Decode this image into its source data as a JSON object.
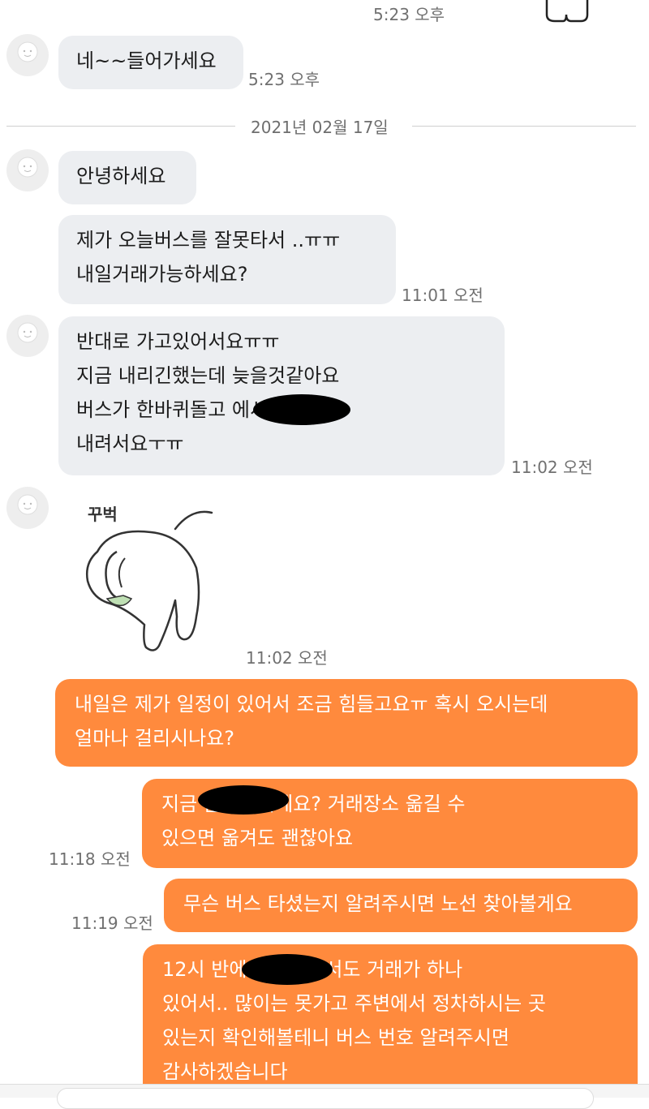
{
  "chat": {
    "top_partial_time": "5:23 오후",
    "m1": {
      "text": "네~~들어가세요",
      "time": "5:23 오후"
    },
    "date_divider": "2021년 02월 17일",
    "m2": {
      "text": "안녕하세요"
    },
    "m3": {
      "text": "제가 오늘버스를  잘못타서 ..ㅠㅠ\n내일거래가능하세요?",
      "time": "11:01 오전"
    },
    "m4": {
      "text": "반대로 가고있어서요ㅠㅠ\n지금  내리긴했는데  늦을것같아요\n버스가  한바퀴돌고            에서\n내려서요ㅜㅠ",
      "time": "11:02 오전"
    },
    "sticker": {
      "caption": "꾸벅",
      "time": "11:02 오전",
      "icon": "bowing-bunny-sticker"
    },
    "m5": {
      "text": "내일은 제가 일정이 있어서 조금 힘들고요ㅠ 혹시 오시는데\n얼마나 걸리시나요?"
    },
    "m6": {
      "text": "지금              쯤이신거에요? 거래장소 옮길 수\n있으면 옮겨도 괜찮아요",
      "time": "11:18 오전"
    },
    "m7": {
      "text": "무슨 버스 타셨는지 알려주시면 노선 찾아볼게요",
      "time": "11:19 오전"
    },
    "m8": {
      "text": "12시 반에              정문쪽에서도 거래가 하나\n있어서.. 많이는 못가고 주변에서 정차하시는 곳\n있는지 확인해볼테니 버스 번호 알려주시면\n감사하겠습니다"
    }
  },
  "colors": {
    "outgoing": "#ff8a3d",
    "incoming": "#eceef1",
    "redaction": "#000000"
  }
}
